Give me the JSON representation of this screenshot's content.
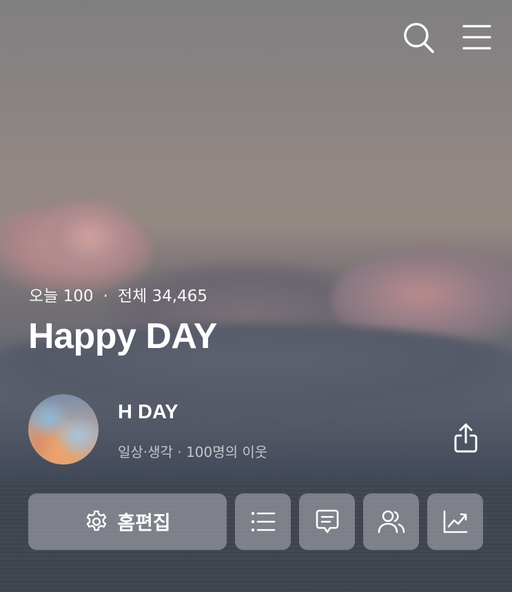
{
  "header": {
    "search_icon": "search-icon",
    "menu_icon": "hamburger-menu-icon"
  },
  "blog": {
    "today_label": "오늘 100",
    "separator": "·",
    "total_label": "전체 34,465",
    "title": "Happy DAY"
  },
  "profile": {
    "name": "H DAY",
    "subtitle": "일상·생각 · 100명의 이웃",
    "share_icon": "share-icon"
  },
  "actions": {
    "edit_label": "홈편집",
    "edit_icon": "gear-icon",
    "list_icon": "list-icon",
    "chat_icon": "message-icon",
    "friends_icon": "neighbors-icon",
    "stats_icon": "stats-chart-icon"
  }
}
